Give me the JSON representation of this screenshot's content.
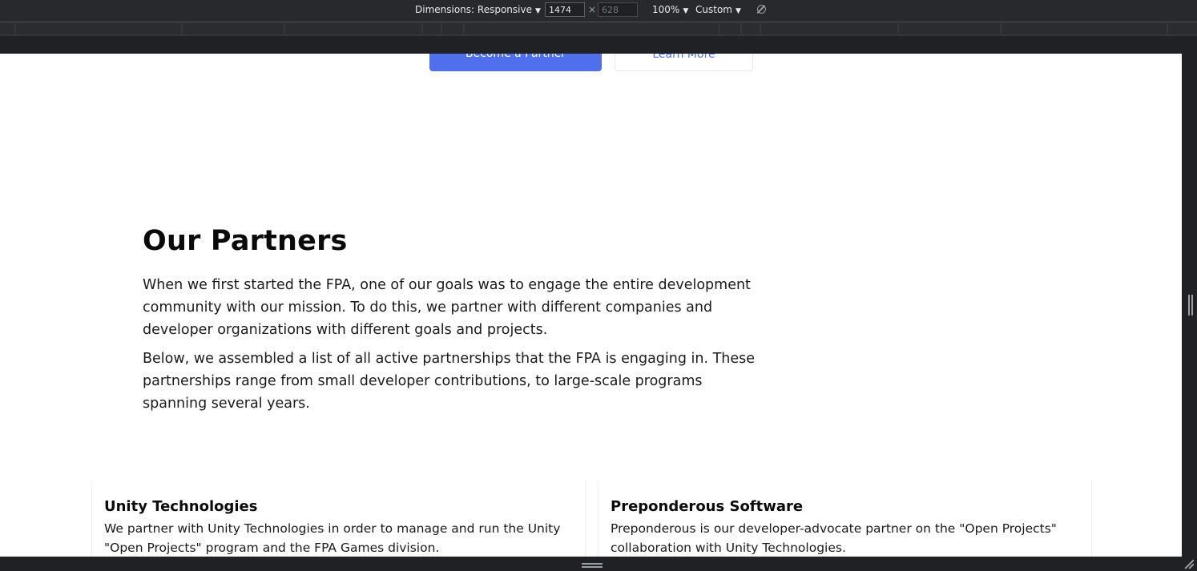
{
  "devtools": {
    "dimensions_label": "Dimensions: Responsive",
    "width_value": "1474",
    "height_placeholder": "628",
    "times_symbol": "×",
    "zoom_label": "100%",
    "throttle_label": "Custom",
    "caret": "▼"
  },
  "page": {
    "buttons": {
      "primary": "Become a Partner",
      "secondary": "Learn More"
    },
    "section": {
      "title": "Our Partners",
      "paragraphs": [
        "When we first started the FPA, one of our goals was to engage the entire development community with our mission. To do this, we partner with different companies and developer organizations with different goals and projects.",
        "Below, we assembled a list of all active partnerships that the FPA is engaging in. These partnerships range from small developer contributions, to large-scale programs spanning several years."
      ]
    },
    "partners": [
      {
        "name": "Unity Technologies",
        "description": "We partner with Unity Technologies in order to manage and run the Unity \"Open Projects\" program and the FPA Games division."
      },
      {
        "name": "Preponderous Software",
        "description": "Preponderous is our developer-advocate partner on the \"Open Projects\" collaboration with Unity Technologies."
      }
    ]
  },
  "colors": {
    "accent": "#4f6fed",
    "devtools_bg": "#28292c"
  }
}
